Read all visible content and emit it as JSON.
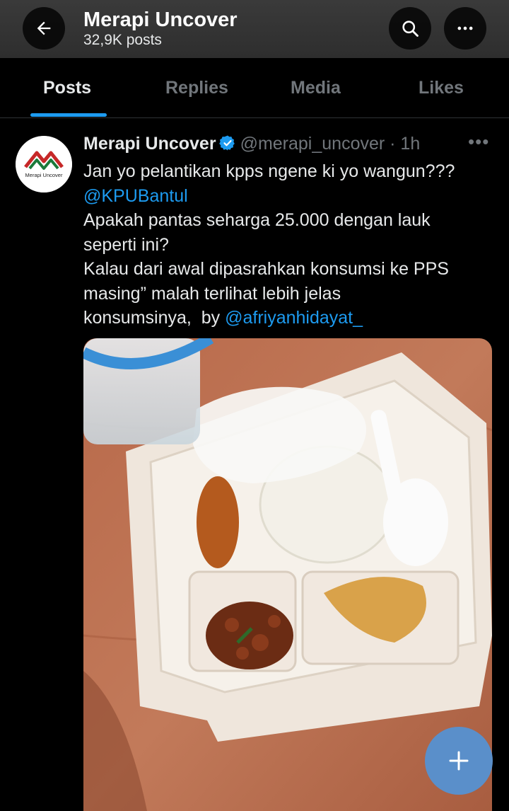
{
  "header": {
    "title": "Merapi Uncover",
    "post_count": "32,9K posts"
  },
  "tabs": [
    {
      "label": "Posts",
      "active": true
    },
    {
      "label": "Replies",
      "active": false
    },
    {
      "label": "Media",
      "active": false
    },
    {
      "label": "Likes",
      "active": false
    }
  ],
  "post": {
    "author_name": "Merapi Uncover",
    "handle": "@merapi_uncover",
    "time": " · 1h",
    "avatar_text": "Merapi Uncover",
    "lines": [
      "Jan yo pelantikan kpps ngene ki yo wangun???",
      "@KPUBantul",
      "Apakah pantas seharga 25.000 dengan lauk",
      "seperti ini?",
      "Kalau dari awal dipasrahkan konsumsi ke PPS",
      "masing” malah terlihat lebih jelas",
      "konsumsinya,  by ",
      "@afriyanhidayat_"
    ]
  },
  "colors": {
    "accent": "#1d9bf0",
    "background": "#000000",
    "fab": "#5a8fca"
  },
  "icons": [
    "back-arrow-icon",
    "search-icon",
    "more-icon",
    "verified-badge-icon",
    "post-more-icon",
    "compose-plus-icon"
  ]
}
